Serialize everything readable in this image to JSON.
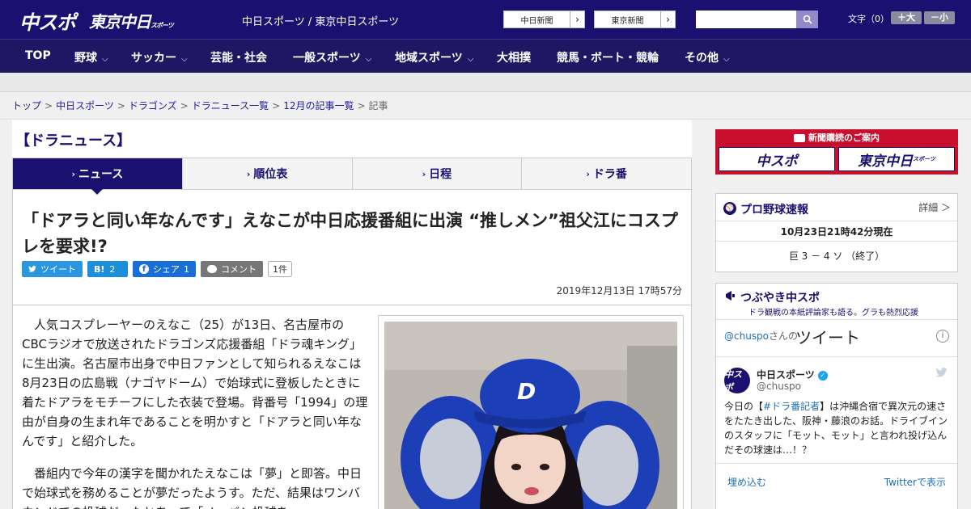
{
  "header": {
    "logo_chunichi": "中スポ",
    "logo_tokyo": "東京中日",
    "logo_tokyo_sub": "スポーツ",
    "site_description": "中日スポーツ / 東京中日スポーツ",
    "btn_chunichi_shimbun": "中日新聞",
    "btn_tokyo_shimbun": "東京新聞",
    "font_size_label": "文字（0）",
    "font_larger": "＋大",
    "font_smaller": "－小"
  },
  "nav": [
    {
      "label": "TOP",
      "dropdown": false
    },
    {
      "label": "野球",
      "dropdown": true
    },
    {
      "label": "サッカー",
      "dropdown": true
    },
    {
      "label": "芸能・社会",
      "dropdown": false
    },
    {
      "label": "一般スポーツ",
      "dropdown": true
    },
    {
      "label": "地域スポーツ",
      "dropdown": true
    },
    {
      "label": "大相撲",
      "dropdown": false
    },
    {
      "label": "競馬・ボート・競輪",
      "dropdown": false
    },
    {
      "label": "その他",
      "dropdown": true
    }
  ],
  "breadcrumb": {
    "items": [
      "トップ",
      "中日スポーツ",
      "ドラゴンズ",
      "ドラニュース一覧",
      "12月の記事一覧"
    ],
    "current": "記事"
  },
  "section_title": "【ドラニュース】",
  "tabs": [
    {
      "label": "ニュース",
      "active": true
    },
    {
      "label": "順位表",
      "active": false
    },
    {
      "label": "日程",
      "active": false
    },
    {
      "label": "ドラ番",
      "active": false
    }
  ],
  "article": {
    "headline": "「ドアラと同い年なんです」えなこが中日応援番組に出演 “推しメン”祖父江にコスプレを要求!?",
    "share": {
      "tweet": "ツイート",
      "hatena": "B!",
      "hatena_count": "2",
      "facebook": "シェア",
      "facebook_count": "1",
      "comment": "コメント",
      "comment_count": "1件"
    },
    "datetime": "2019年12月13日 17時57分",
    "paragraphs": [
      "人気コスプレーヤーのえなこ（25）が13日、名古屋市のCBCラジオで放送されたドラゴンズ応援番組「ドラ魂キング」に生出演。名古屋市出身で中日ファンとして知られるえなこは8月23日の広島戦（ナゴヤドーム）で始球式に登板したときに着たドアラをモチーフにした衣装で登場。背番号「1994」の理由が自身の生まれ年であることを明かすと「ドアラと同い年なんです」と紹介した。",
      "番組内で今年の漢字を聞かれたえなこは「夢」と即答。中日で始球式を務めることが夢だったようす。ただ、結果はワンバウンドでの投球だったとあって「ノーバン投球を"
    ]
  },
  "sidebar": {
    "ad_title": "新聞購読のご案内",
    "ad_logo_1": "中スポ",
    "ad_logo_2": "東京中日",
    "ad_logo_2_sub": "スポーツ",
    "baseball": {
      "title": "プロ野球速報",
      "detail": "詳細 ＞",
      "timestamp": "10月23日21時42分現在",
      "score": "巨 3 － 4 ソ （終了）"
    },
    "tweets": {
      "title": "つぶやき中スポ",
      "subtitle": "ドラ観戦の本紙評論家も語る。グラも熱烈応援",
      "handle": "@chuspo",
      "handle_suffix": "さんの",
      "heading": "ツイート",
      "info": "i",
      "account_name": "中日スポーツ",
      "verified": "✓",
      "screen_name": "@chuspo",
      "avatar_text": "中スポ",
      "text_before": "今日の【",
      "hashtag": "#ドラ番記者",
      "text_after": "】は沖縄合宿で異次元の速さをたたき出した、阪神・藤浪のお話。ドライブインのスタッフに「モット、モット」と言われ投げ込んだその球速は…！？",
      "embed": "埋め込む",
      "view_on_twitter": "Twitterで表示"
    }
  }
}
